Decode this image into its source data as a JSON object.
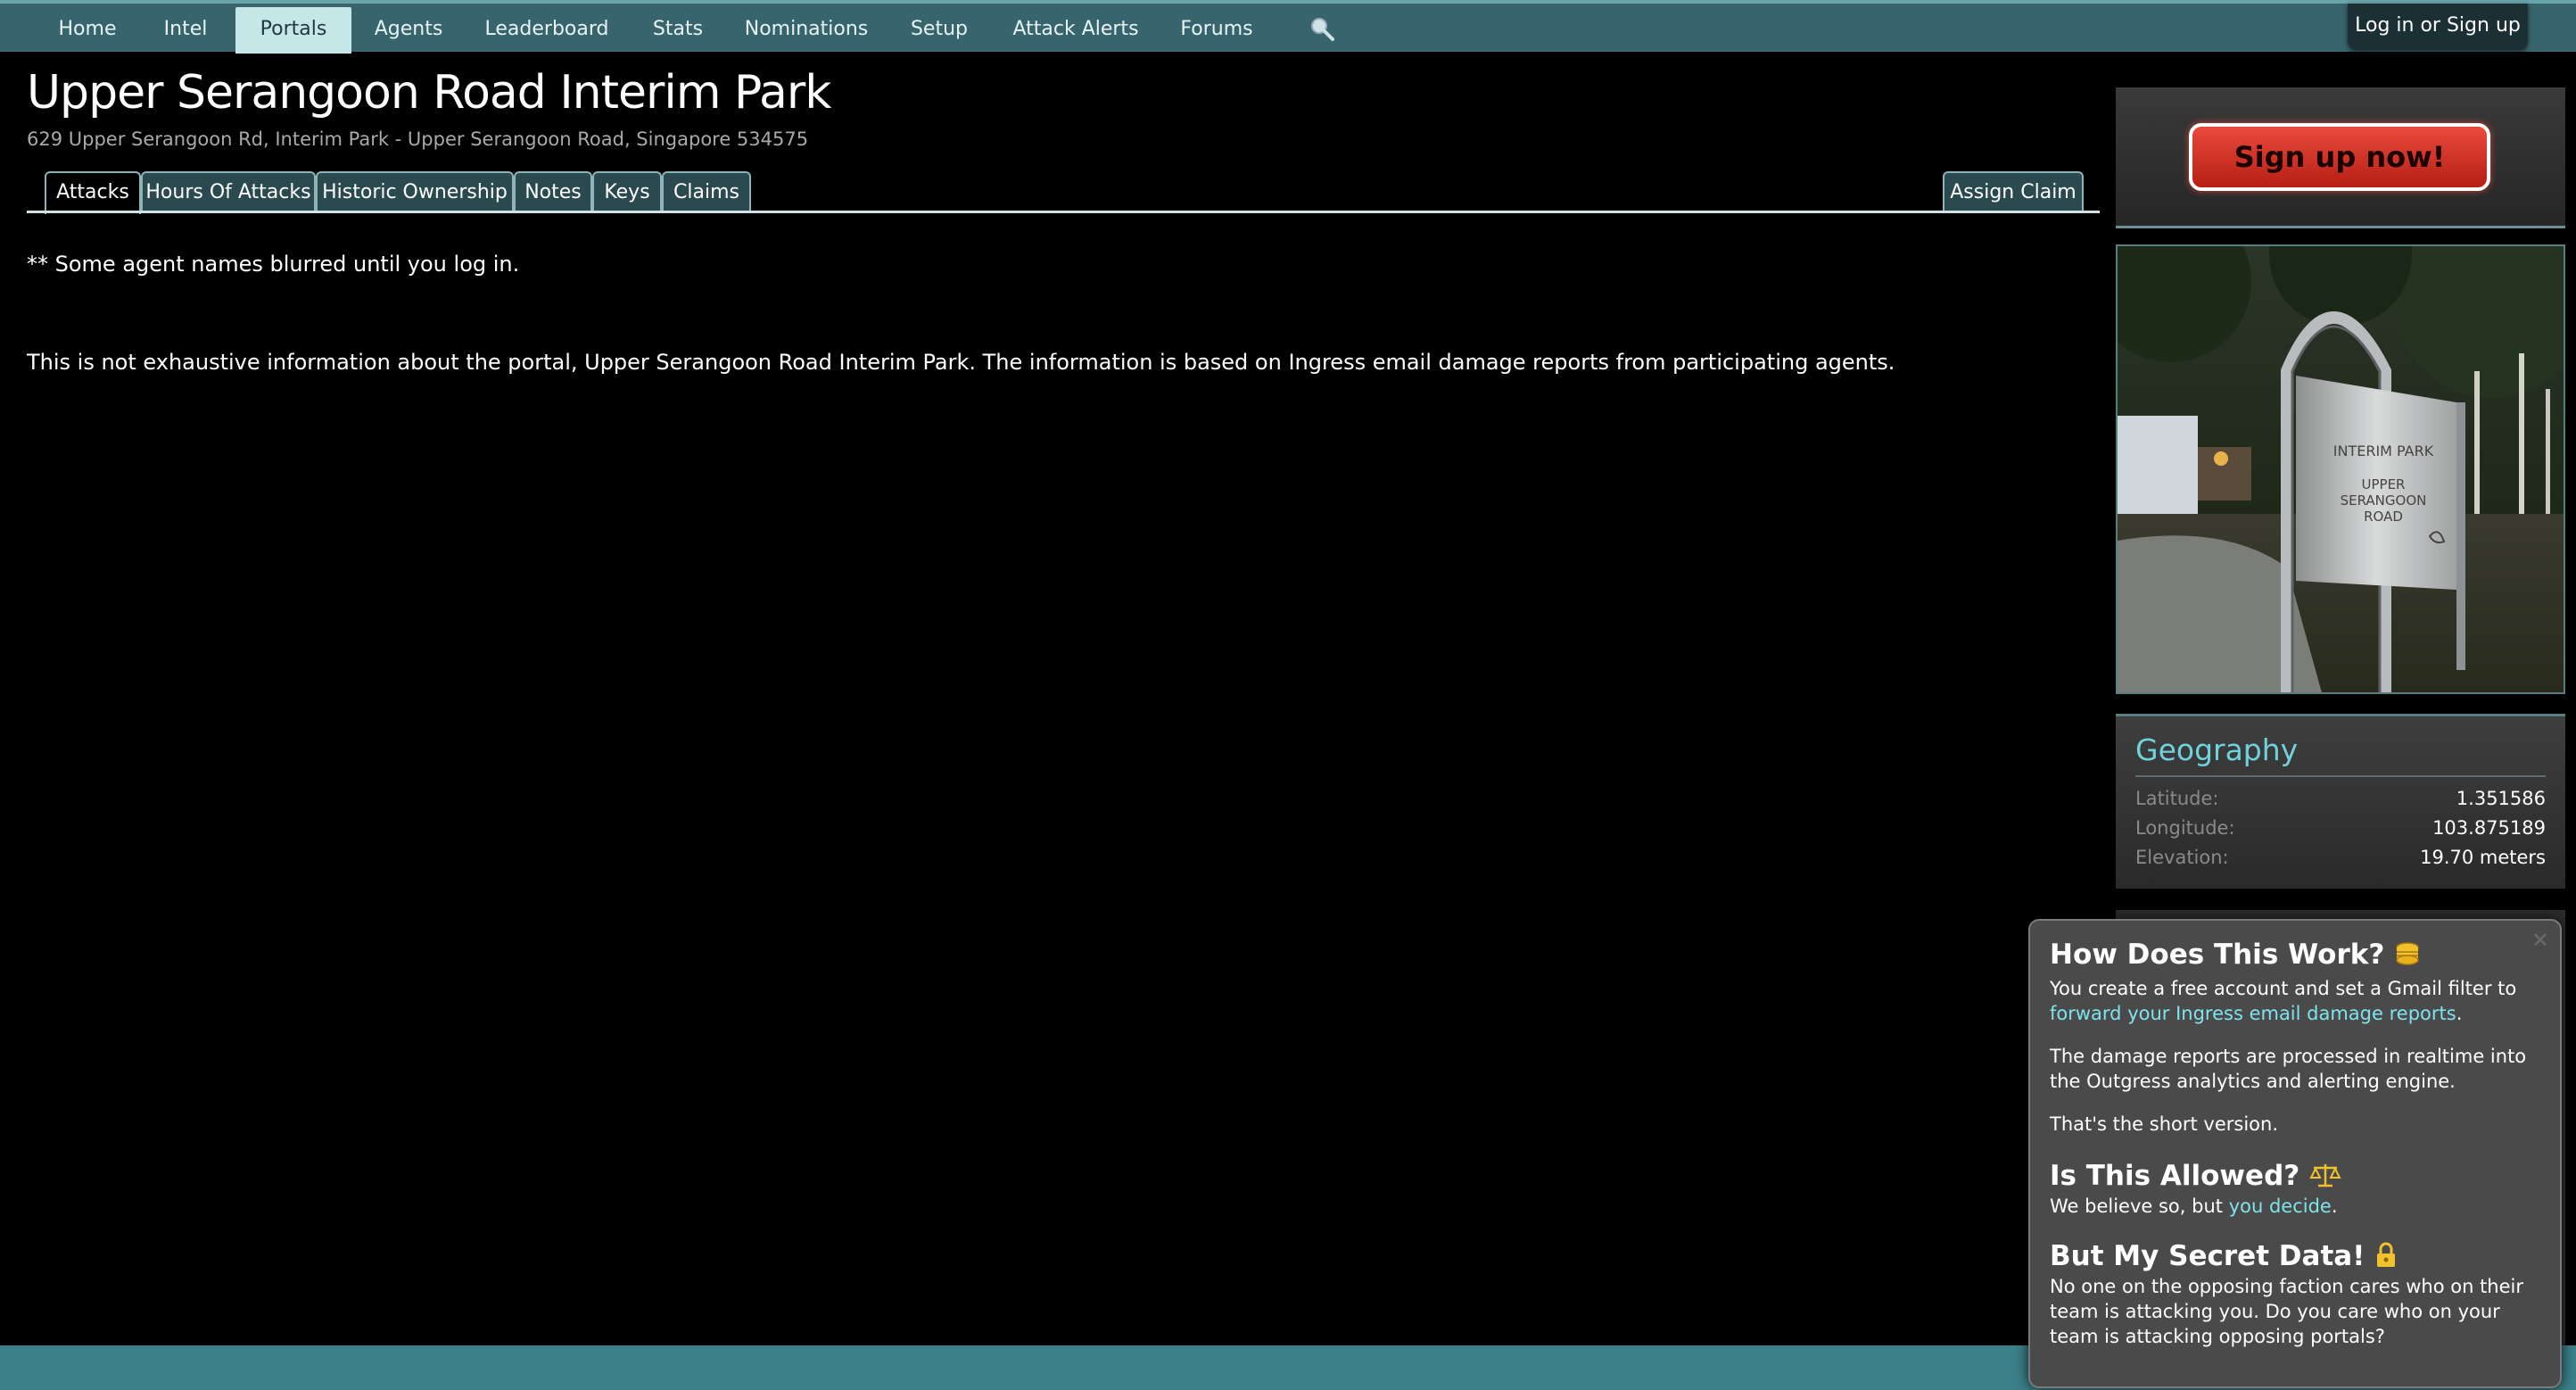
{
  "nav": {
    "items": [
      {
        "label": "Home"
      },
      {
        "label": "Intel"
      },
      {
        "label": "Portals"
      },
      {
        "label": "Agents"
      },
      {
        "label": "Leaderboard"
      },
      {
        "label": "Stats"
      },
      {
        "label": "Nominations"
      },
      {
        "label": "Setup"
      },
      {
        "label": "Attack Alerts"
      },
      {
        "label": "Forums"
      }
    ],
    "active": "Portals",
    "search_icon": "magnifier-icon",
    "login_label": "Log in or Sign up"
  },
  "portal": {
    "title": "Upper Serangoon Road Interim Park",
    "address": "629 Upper Serangoon Rd, Interim Park - Upper Serangoon Road, Singapore 534575"
  },
  "tabs": {
    "items": [
      {
        "label": "Attacks"
      },
      {
        "label": "Hours Of Attacks"
      },
      {
        "label": "Historic Ownership"
      },
      {
        "label": "Notes"
      },
      {
        "label": "Keys"
      },
      {
        "label": "Claims"
      }
    ],
    "selected": "Attacks",
    "assign_claim": "Assign Claim"
  },
  "content": {
    "blur_note": "** Some agent names blurred until you log in.",
    "disclaimer": "This is not exhaustive information about the portal, Upper Serangoon Road Interim Park. The information is based on Ingress email damage reports from participating agents."
  },
  "sidebar": {
    "signup_label": "Sign up now!",
    "photo_sign_text": [
      "INTERIM PARK",
      "UPPER",
      "SERANGOON",
      "ROAD"
    ],
    "geography": {
      "title": "Geography",
      "rows": [
        {
          "label": "Latitude:",
          "value": "1.351586"
        },
        {
          "label": "Longitude:",
          "value": "103.875189"
        },
        {
          "label": "Elevation:",
          "value": "19.70 meters"
        }
      ]
    }
  },
  "popup": {
    "h1": "How Does This Work?",
    "p1_text": "You create a free account and set a Gmail filter to ",
    "p1_link": "forward your Ingress email damage reports",
    "p1_end": ".",
    "p2": "The damage reports are processed in realtime into the Outgress analytics and alerting engine.",
    "p3": "That's the short version.",
    "h2": "Is This Allowed?",
    "p4_text": "We believe so, but ",
    "p4_link": "you decide",
    "p4_end": ".",
    "h3": "But My Secret Data!",
    "p5": "No one on the opposing faction cares who on their team is attacking you. Do you care who on your team is attacking opposing portals?",
    "close_icon": "close-icon"
  },
  "colors": {
    "nav_bg": "#38656d",
    "accent": "#6fd2dc",
    "signup_red": "#d8372a",
    "footer": "#3b7f88"
  }
}
